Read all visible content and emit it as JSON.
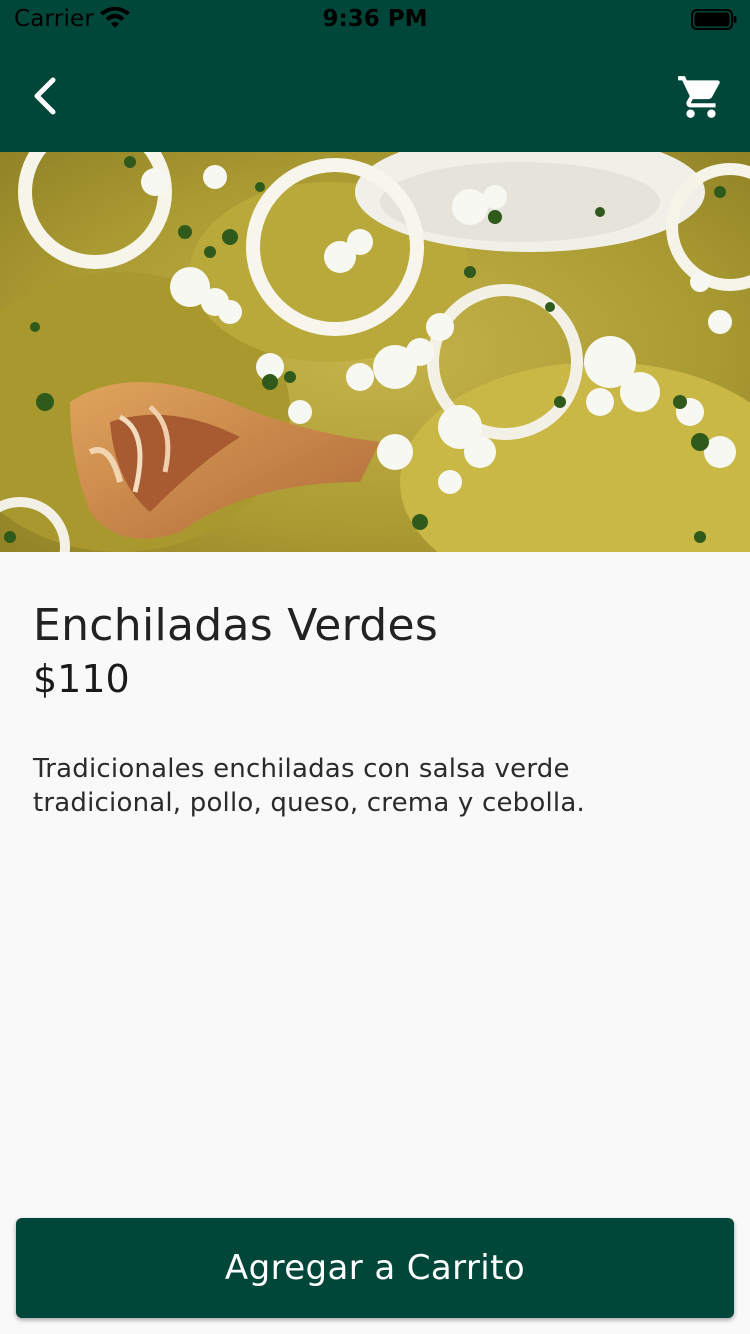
{
  "status_bar": {
    "carrier": "Carrier",
    "time": "9:36 PM",
    "wifi_icon": "wifi-icon",
    "battery_icon": "battery-icon"
  },
  "nav_bar": {
    "back_icon": "chevron-left-icon",
    "cart_icon": "shopping-cart-icon",
    "background_color": "#00473a"
  },
  "product": {
    "image": "enchiladas-verdes-photo",
    "name": "Enchiladas Verdes",
    "price": "$110",
    "description": "Tradicionales enchiladas con salsa verde tradicional, pollo, queso, crema y cebolla."
  },
  "actions": {
    "add_to_cart_label": "Agregar a Carrito",
    "button_color": "#00473a"
  }
}
